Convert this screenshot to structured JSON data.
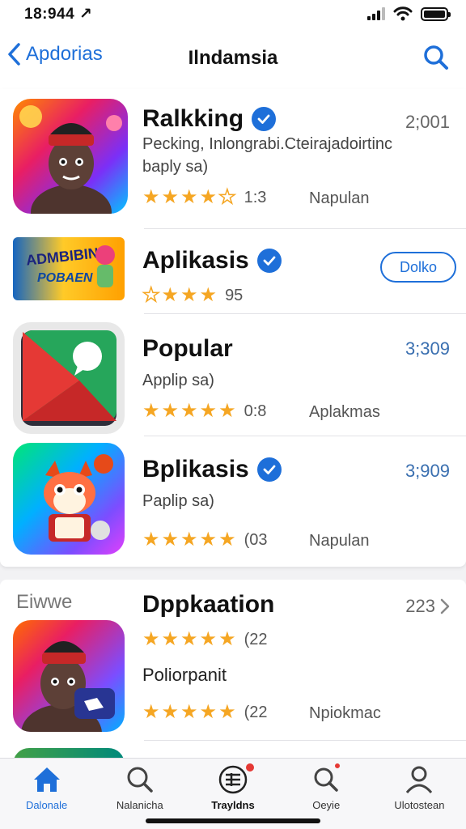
{
  "status_bar": {
    "time": "18:944 ↗"
  },
  "nav": {
    "back_label": "Apdorias",
    "title": "Ilndamsia"
  },
  "apps": [
    {
      "title": "Ralkking",
      "verified": true,
      "subtitle": "Pecking, Inlongrabi.Cteirajadoirtinc baply sa)",
      "stars": 4,
      "rating_count": "1:3",
      "category": "Napulan",
      "meta": "2;001"
    },
    {
      "title": "Aplikasis",
      "verified": true,
      "stars": 4,
      "rating_count": "95",
      "button_label": "Dolko",
      "icon_text_1": "ADMBIBIN",
      "icon_text_2": "POBAEN"
    },
    {
      "title": "Popular",
      "verified": false,
      "subtitle": "Applip sa)",
      "stars": 5,
      "rating_count": "0:8",
      "category": "Aplakmas",
      "meta": "3;309"
    },
    {
      "title": "Bplikasis",
      "verified": true,
      "subtitle": "Paplip sa)",
      "stars": 5,
      "rating_count": "(03",
      "category": "Napulan",
      "meta": "3;909"
    }
  ],
  "section": {
    "label": "Eiwwe",
    "title": "Dppkaation",
    "meta": "223",
    "stars": 5,
    "rating_count": "(22",
    "subtitle": "Poliorpanit",
    "stars_2": 5,
    "rating_count_2": "(22",
    "category": "Npiokmac"
  },
  "tabs": [
    {
      "label": "Dalonale",
      "icon": "home-icon",
      "active": true
    },
    {
      "label": "Nalanicha",
      "icon": "search-icon",
      "active": false
    },
    {
      "label": "Trayldns",
      "icon": "list-icon",
      "active": false,
      "badge": true
    },
    {
      "label": "Oeyie",
      "icon": "magnifier-icon",
      "active": false,
      "badge": true
    },
    {
      "label": "Ulotostean",
      "icon": "profile-icon",
      "active": false
    }
  ],
  "colors": {
    "accent": "#1e6fd9",
    "star": "#f5a623",
    "badge": "#e53935"
  }
}
